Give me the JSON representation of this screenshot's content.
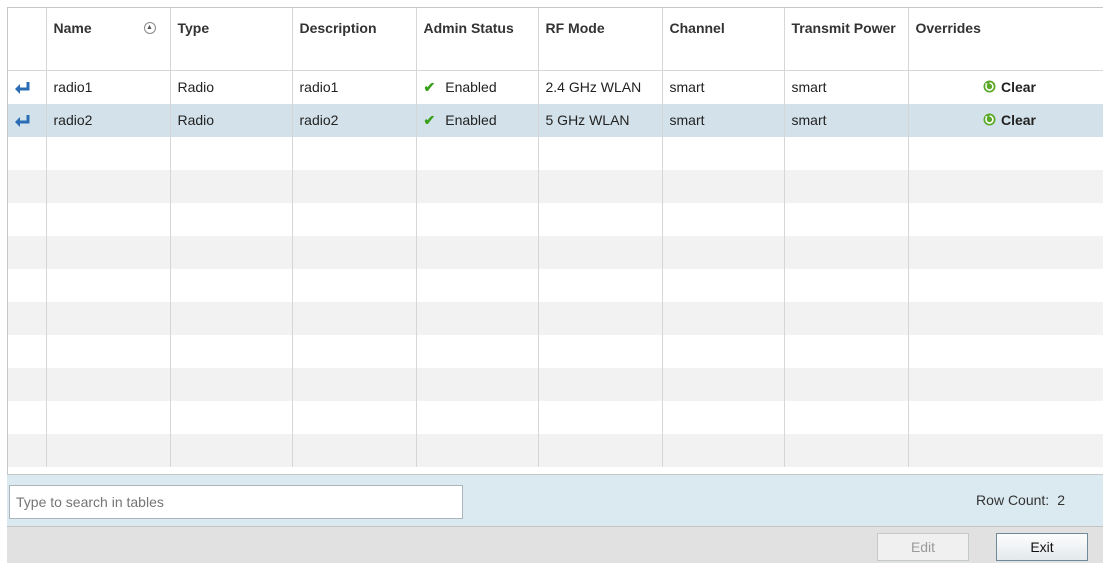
{
  "table": {
    "columns": [
      "",
      "Name",
      "Type",
      "Description",
      "Admin Status",
      "RF Mode",
      "Channel",
      "Transmit Power",
      "Overrides"
    ],
    "rows": [
      {
        "name": "radio1",
        "type": "Radio",
        "description": "radio1",
        "admin_status": "Enabled",
        "rf_mode": "2.4 GHz WLAN",
        "channel": "smart",
        "transmit_power": "smart",
        "override": "Clear"
      },
      {
        "name": "radio2",
        "type": "Radio",
        "description": "radio2",
        "admin_status": "Enabled",
        "rf_mode": "5 GHz WLAN",
        "channel": "smart",
        "transmit_power": "smart",
        "override": "Clear"
      }
    ],
    "selected_row": 2
  },
  "footer": {
    "search_placeholder": "Type to search in tables",
    "row_count_label": "Row Count:",
    "row_count_value": "2"
  },
  "actions": {
    "edit_label": "Edit",
    "exit_label": "Exit"
  },
  "icons": {
    "row": "enter-arrow-icon",
    "status": "check-icon",
    "clear": "refresh-icon",
    "sort": "sort-icon"
  },
  "colors": {
    "selected_row": "#d3e2ea",
    "footer_bg": "#dbe9f1",
    "status_check": "#3aa01c",
    "clear_icon": "#5aa828",
    "row_icon": "#2a6db5"
  }
}
